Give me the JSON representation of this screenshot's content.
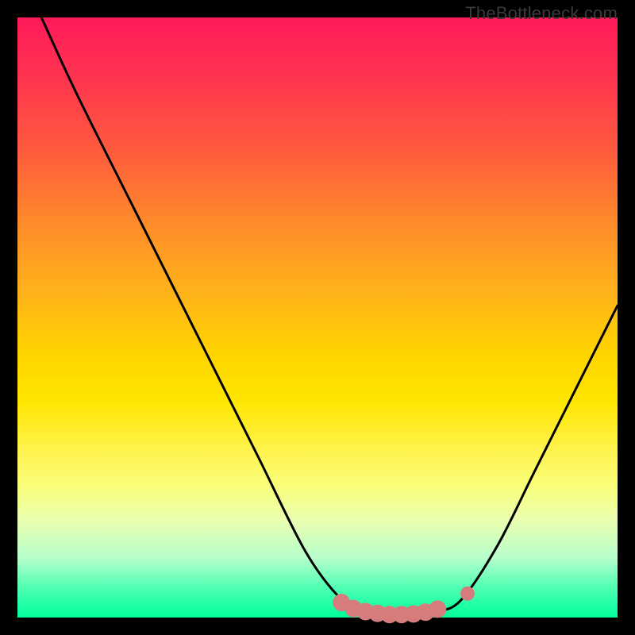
{
  "site_label": "TheBottleneck.com",
  "colors": {
    "gradient_top": "#ff1a5a",
    "gradient_mid": "#ffe600",
    "gradient_bottom": "#00ff99",
    "curve": "#000000",
    "markers": "#d77c7c",
    "frame": "#000000"
  },
  "chart_data": {
    "type": "line",
    "title": "",
    "xlabel": "",
    "ylabel": "",
    "xlim": [
      0,
      100
    ],
    "ylim": [
      0,
      100
    ],
    "grid": false,
    "note": "V-shaped bottleneck curve on red-yellow-green gradient. y ≈ 100 is top (severe bottleneck, red), y ≈ 0 is bottom (optimal, green). Values estimated from pixel positions; no axis ticks present.",
    "series": [
      {
        "name": "bottleneck-curve",
        "x": [
          4,
          10,
          20,
          30,
          40,
          48,
          54,
          58,
          62,
          66,
          70,
          74,
          80,
          86,
          92,
          100
        ],
        "y": [
          100,
          87,
          67,
          47,
          27,
          11,
          3,
          1,
          0.5,
          0.5,
          1,
          3,
          12,
          24,
          36,
          52
        ]
      }
    ],
    "markers": {
      "name": "salmon-dots",
      "note": "cluster of salmon-pink markers along the flat valley and one small marker on the right slope",
      "points": [
        {
          "x": 54,
          "y": 2.5
        },
        {
          "x": 56,
          "y": 1.5
        },
        {
          "x": 58,
          "y": 1.0
        },
        {
          "x": 60,
          "y": 0.7
        },
        {
          "x": 62,
          "y": 0.5
        },
        {
          "x": 64,
          "y": 0.5
        },
        {
          "x": 66,
          "y": 0.6
        },
        {
          "x": 68,
          "y": 0.9
        },
        {
          "x": 70,
          "y": 1.4
        },
        {
          "x": 75,
          "y": 4.0
        }
      ],
      "radius_main_px": 11,
      "radius_end_px": 9
    }
  }
}
